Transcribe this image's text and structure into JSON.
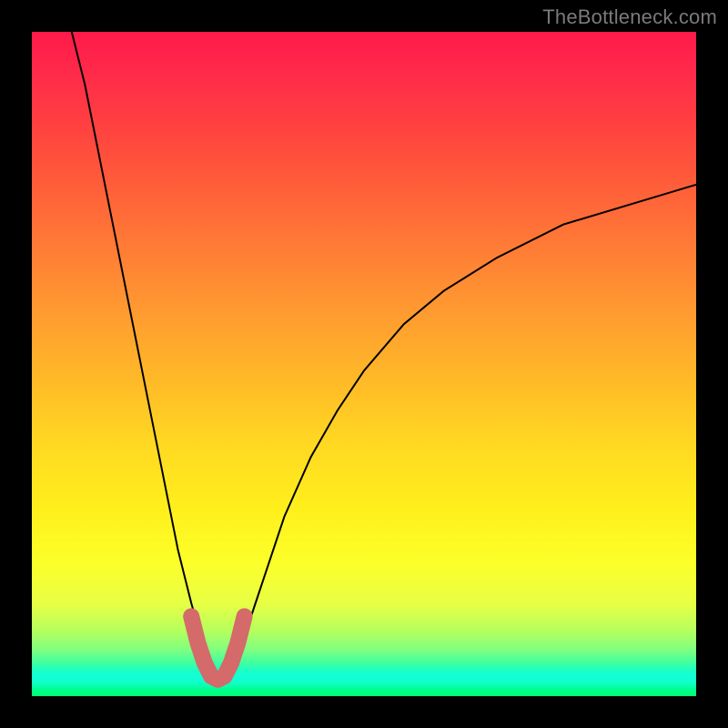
{
  "watermark": "TheBottleneck.com",
  "chart_data": {
    "type": "line",
    "title": "",
    "xlabel": "",
    "ylabel": "",
    "xlim": [
      0,
      100
    ],
    "ylim": [
      0,
      100
    ],
    "grid": false,
    "legend": false,
    "series": [
      {
        "name": "bottleneck-curve",
        "x": [
          6,
          8,
          10,
          12,
          14,
          16,
          18,
          20,
          22,
          24,
          26,
          27,
          28,
          29,
          30,
          32,
          34,
          36,
          38,
          42,
          46,
          50,
          56,
          62,
          70,
          80,
          90,
          100
        ],
        "y": [
          100,
          92,
          82,
          72,
          62,
          52,
          42,
          32,
          22,
          14,
          7,
          4,
          2.5,
          2.5,
          4,
          9,
          15,
          21,
          27,
          36,
          43,
          49,
          56,
          61,
          66,
          71,
          74,
          77
        ]
      }
    ],
    "highlight": {
      "name": "valley-highlight",
      "x": [
        24,
        25,
        26,
        27,
        28,
        29,
        30,
        31,
        32
      ],
      "y": [
        12,
        8,
        5,
        3,
        2.5,
        3,
        5,
        8,
        12
      ]
    },
    "minimum": {
      "x": 28,
      "y": 2.5
    }
  }
}
